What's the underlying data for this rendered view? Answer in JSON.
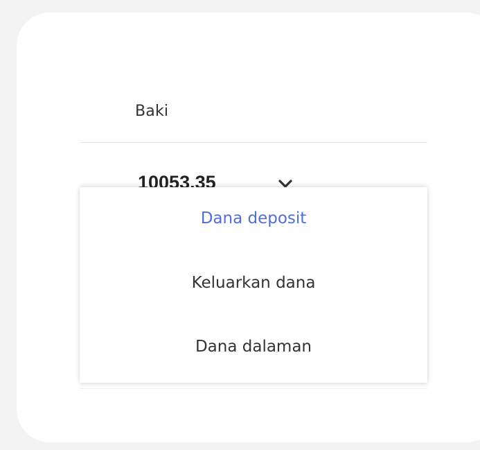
{
  "balance": {
    "label": "Baki",
    "value": "10053.35",
    "dropdown_icon": "chevron-down-icon"
  },
  "menu": {
    "items": [
      {
        "label": "Dana deposit",
        "active": true
      },
      {
        "label": "Keluarkan dana",
        "active": false
      },
      {
        "label": "Dana dalaman",
        "active": false
      }
    ]
  },
  "colors": {
    "active": "#4f6fd6",
    "text": "#333333",
    "background": "#f3f3f3",
    "card": "#ffffff"
  }
}
